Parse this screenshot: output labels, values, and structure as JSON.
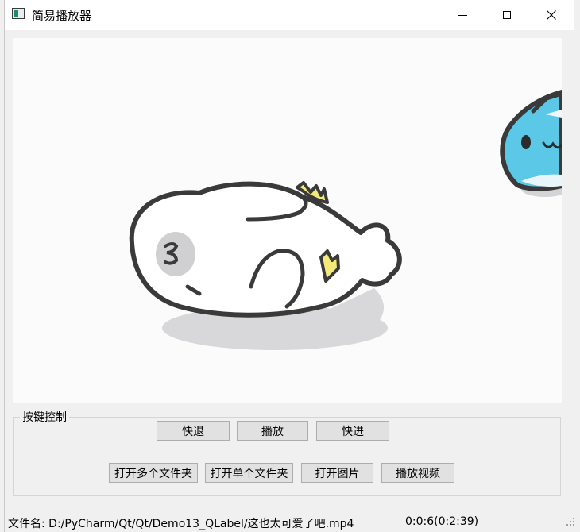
{
  "window": {
    "title": "简易播放器",
    "controls": [
      "minimize",
      "maximize",
      "close"
    ]
  },
  "video": {
    "content": "cartoon-frame",
    "icons": [
      "white-seal-cartoon",
      "blue-fish-cartoon"
    ]
  },
  "controls_group": {
    "title": "按键控制",
    "row1": [
      "快退",
      "播放",
      "快进"
    ],
    "row2": [
      "打开多个文件夹",
      "打开单个文件夹",
      "打开图片",
      "播放视频"
    ]
  },
  "status": {
    "file_label": "文件名:",
    "file_path": "D:/PyCharm/Qt/Qt/Demo13_QLabel/这也太可爱了吧.mp4",
    "time": "0:0:6(0:2:39)"
  },
  "colors": {
    "window_bg": "#f0f0f0",
    "button_bg": "#e1e1e1",
    "button_border": "#adadad",
    "fish_blue": "#5bc8e8",
    "accent_yellow": "#f3ea7a"
  }
}
